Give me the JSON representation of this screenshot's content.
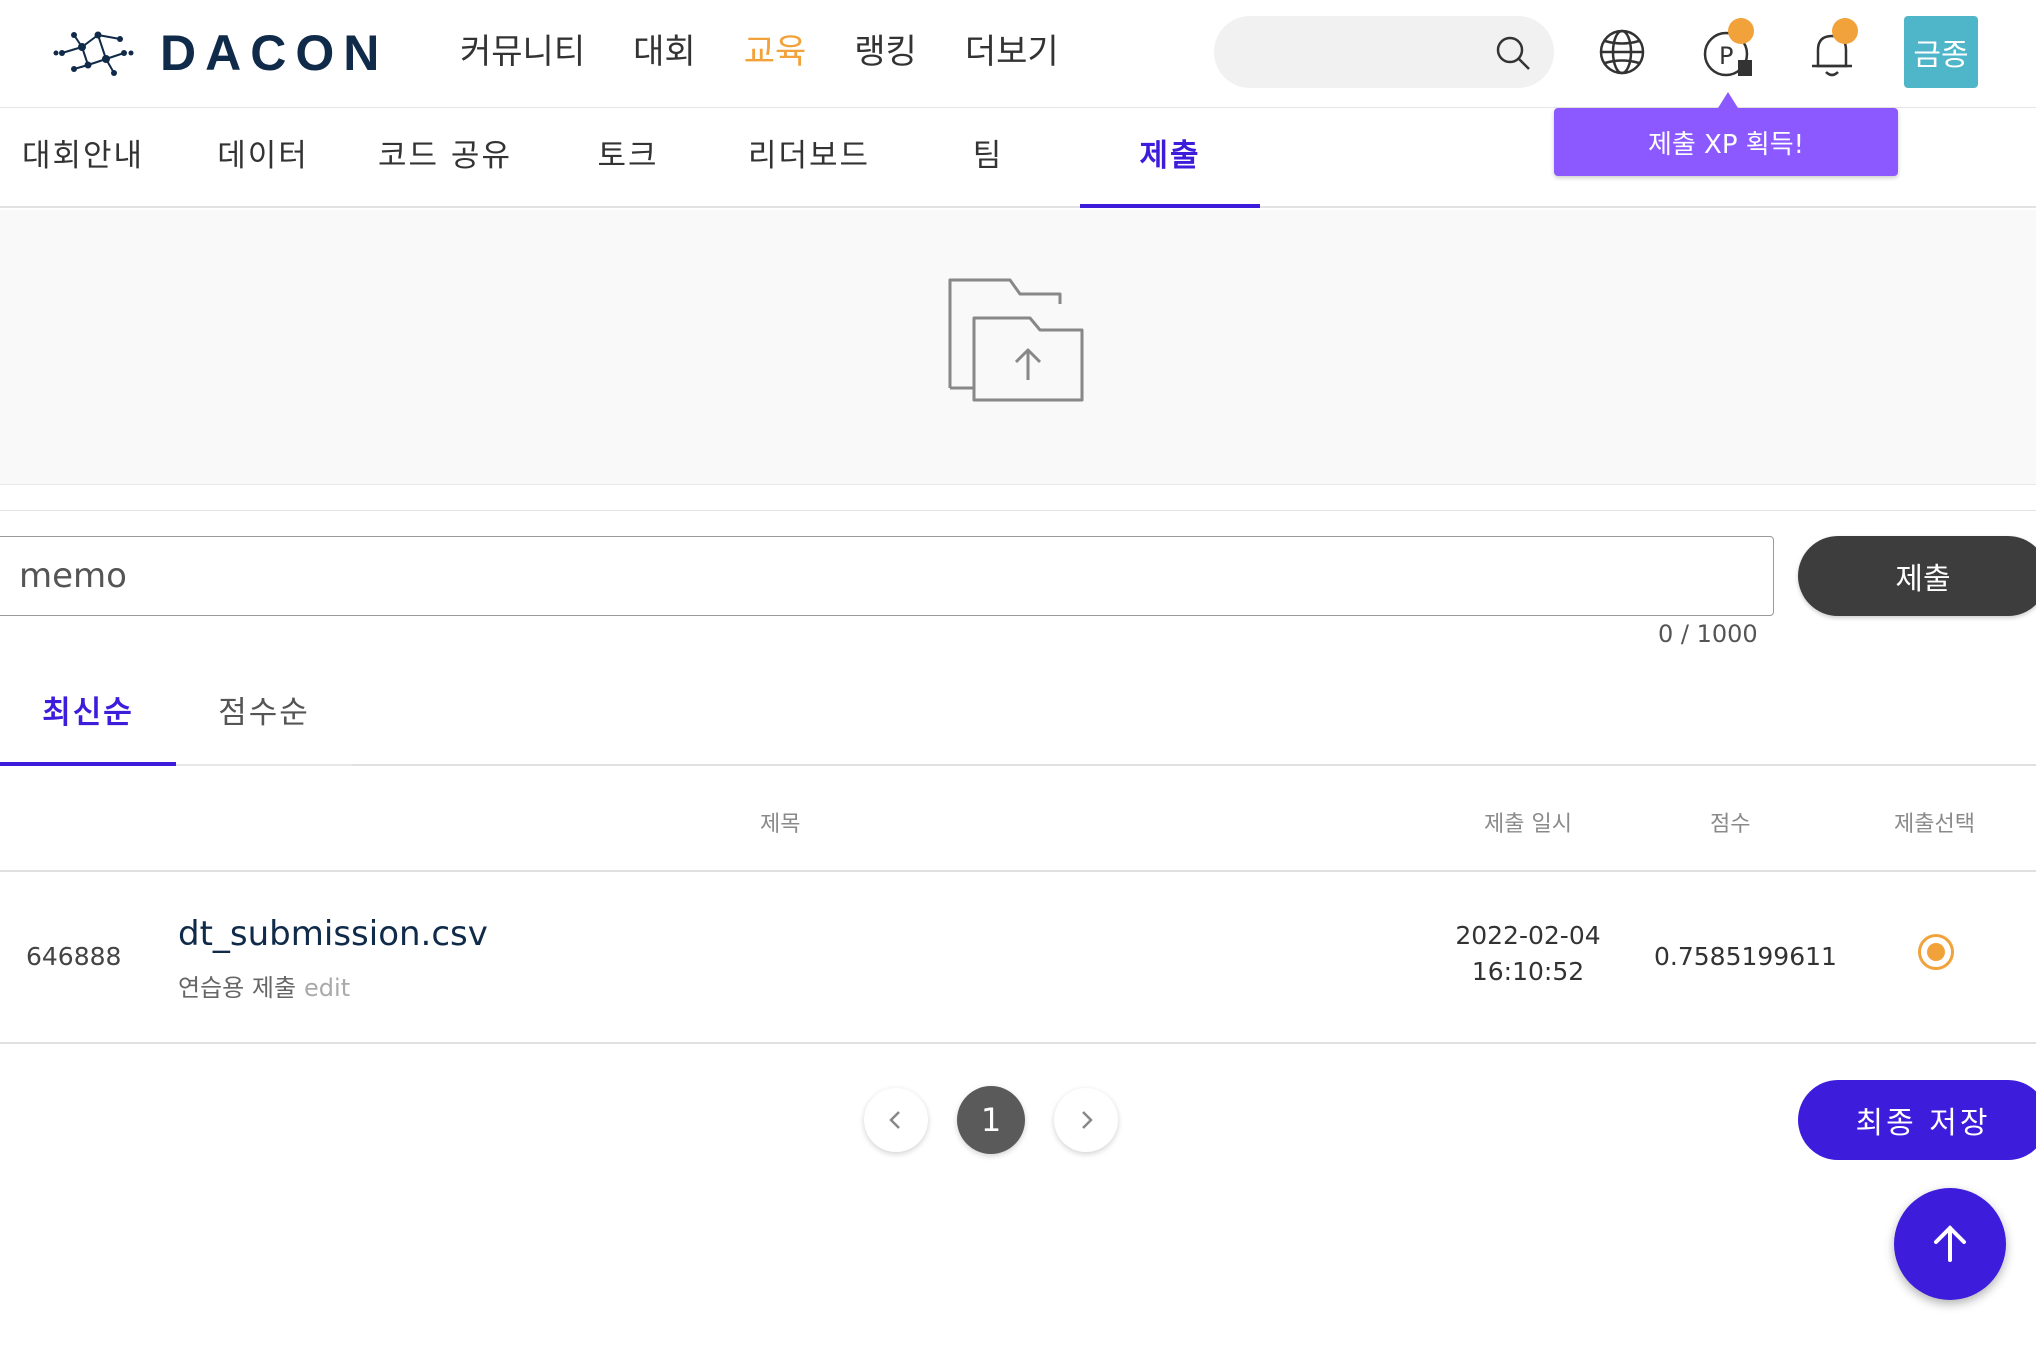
{
  "header": {
    "logo_text": "DACON",
    "nav": [
      "커뮤니티",
      "대회",
      "교육",
      "랭킹",
      "더보기"
    ],
    "nav_active_index": 2,
    "search_placeholder": "",
    "user_label": "금종",
    "tooltip": "제출 XP 획득!"
  },
  "subnav": {
    "tabs": [
      "대회안내",
      "데이터",
      "코드 공유",
      "토크",
      "리더보드",
      "팀",
      "제출"
    ],
    "active": "제출"
  },
  "memo": {
    "placeholder": "memo",
    "counter": "0 / 1000",
    "submit_label": "제출"
  },
  "sort": {
    "tabs": [
      "최신순",
      "점수순"
    ],
    "active": "최신순"
  },
  "table": {
    "headers": {
      "title": "제목",
      "date": "제출 일시",
      "score": "점수",
      "select": "제출선택"
    },
    "rows": [
      {
        "id": "646888",
        "file": "dt_submission.csv",
        "memo": "연습용 제출",
        "edit": "edit",
        "date": "2022-02-04",
        "time": "16:10:52",
        "score": "0.7585199611",
        "selected": true
      }
    ]
  },
  "pagination": {
    "current": "1"
  },
  "final_save_label": "최종 저장",
  "colors": {
    "accent": "#3d1cdc",
    "highlight": "#f2a23a",
    "tooltip": "#8b59ff",
    "avatar": "#4fb5c8",
    "logo": "#102a49"
  },
  "icons": [
    "dacon-logo-icon",
    "search-icon",
    "globe-icon",
    "point-icon",
    "bell-icon",
    "folder-upload-icon",
    "chevron-left-icon",
    "chevron-right-icon",
    "arrow-up-icon"
  ]
}
